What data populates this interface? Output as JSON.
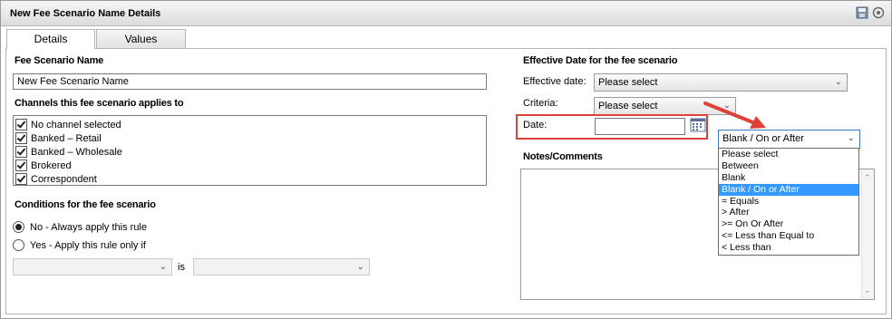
{
  "window": {
    "title": "New Fee Scenario Name Details"
  },
  "tabs": [
    {
      "label": "Details"
    },
    {
      "label": "Values"
    }
  ],
  "fee_scenario": {
    "heading": "Fee Scenario Name",
    "name_value": "New Fee Scenario Name"
  },
  "channels": {
    "heading": "Channels this fee scenario applies to",
    "items": [
      "No channel selected",
      "Banked – Retail",
      "Banked – Wholesale",
      "Brokered",
      "Correspondent"
    ]
  },
  "conditions": {
    "heading": "Conditions for the fee scenario",
    "options": [
      "No - Always apply this rule",
      "Yes - Apply this rule only if"
    ],
    "is_label": "is"
  },
  "effective": {
    "heading": "Effective Date for the fee scenario",
    "effective_date_label": "Effective date:",
    "effective_date_value": "Please select",
    "criteria_label": "Criteria:",
    "criteria_value": "Please select",
    "date_label": "Date:",
    "date_value": "",
    "operator_value": "Blank / On or After",
    "operator_options": [
      "Please select",
      "Between",
      "Blank",
      "Blank / On or After",
      "= Equals",
      "> After",
      ">= On Or After",
      "<= Less than Equal to",
      "< Less than"
    ]
  },
  "notes": {
    "heading": "Notes/Comments"
  },
  "colors": {
    "highlight_border": "#e0403a",
    "arrow": "#e0403a",
    "selected_option": "#3399ff"
  }
}
